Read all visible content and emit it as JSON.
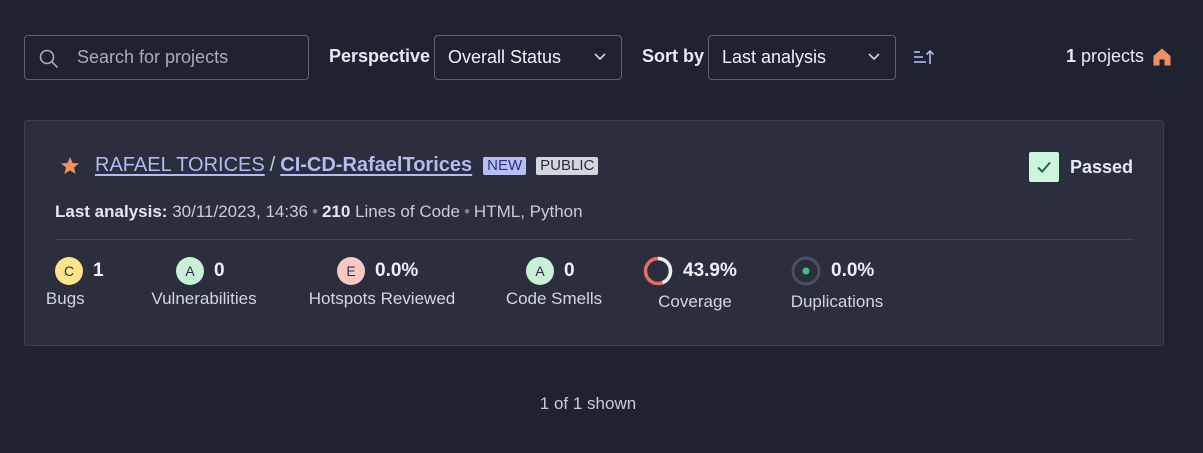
{
  "toolbar": {
    "search_placeholder": "Search for projects",
    "perspective_label": "Perspective",
    "perspective_value": "Overall Status",
    "sort_label": "Sort by",
    "sort_value": "Last analysis",
    "count_number": "1",
    "count_label": "projects"
  },
  "project": {
    "org": "RAFAEL TORICES",
    "separator": "/",
    "name": "CI-CD-RafaelTorices",
    "tag_new": "NEW",
    "tag_public": "PUBLIC",
    "status": "Passed",
    "analysis_label": "Last analysis:",
    "analysis_date": "30/11/2023, 14:36",
    "lines_count": "210",
    "lines_label": "Lines of Code",
    "languages": "HTML, Python",
    "metrics": {
      "bugs": {
        "rating": "C",
        "value": "1",
        "label": "Bugs"
      },
      "vulnerabilities": {
        "rating": "A",
        "value": "0",
        "label": "Vulnerabilities"
      },
      "hotspots": {
        "rating": "E",
        "value": "0.0%",
        "label": "Hotspots Reviewed"
      },
      "code_smells": {
        "rating": "A",
        "value": "0",
        "label": "Code Smells"
      },
      "coverage": {
        "value": "43.9%",
        "label": "Coverage",
        "fraction": 0.439
      },
      "duplications": {
        "value": "0.0%",
        "label": "Duplications"
      }
    }
  },
  "footer": {
    "shown": "1 of 1 shown"
  },
  "colors": {
    "accent_link": "#b4bbf1",
    "star": "#f18f63",
    "home": "#f18f63",
    "passed": "#cdf5dd",
    "coverage_good": "#e6efe9",
    "coverage_bad": "#e46d60"
  }
}
